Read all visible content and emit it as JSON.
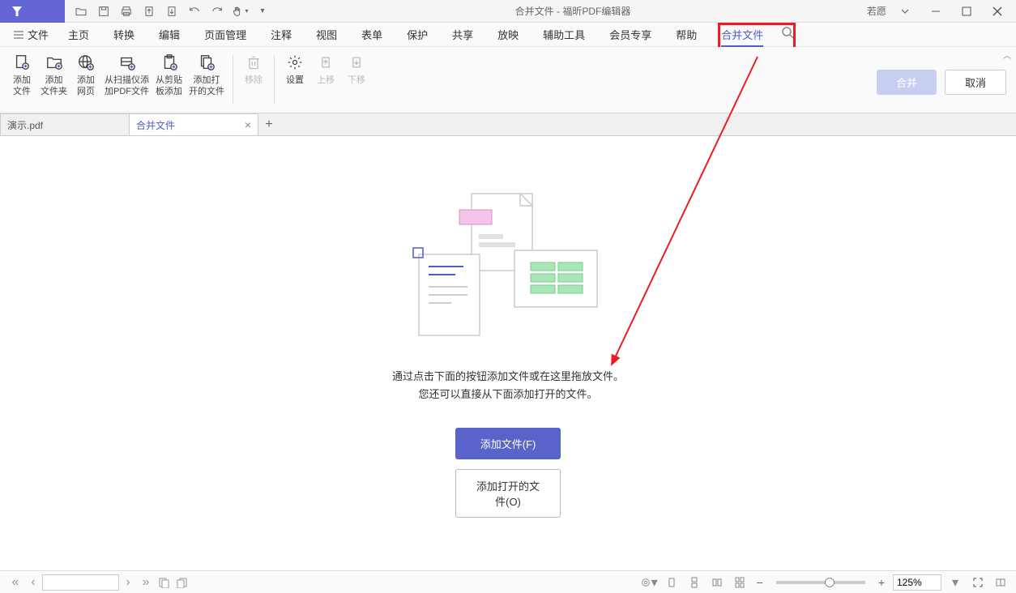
{
  "titlebar": {
    "title": "合并文件 - 福昕PDF编辑器",
    "user": "若愿"
  },
  "menu": {
    "file": "文件",
    "items": [
      "主页",
      "转换",
      "编辑",
      "页面管理",
      "注释",
      "视图",
      "表单",
      "保护",
      "共享",
      "放映",
      "辅助工具",
      "会员专享",
      "帮助",
      "合并文件"
    ]
  },
  "ribbon": {
    "add_file": "添加\n文件",
    "add_folder": "添加\n文件夹",
    "add_web": "添加\n网页",
    "add_scan": "从扫描仪添\n加PDF文件",
    "add_clip": "从剪贴\n板添加",
    "add_open": "添加打\n开的文件",
    "remove": "移除",
    "settings": "设置",
    "move_up": "上移",
    "move_down": "下移",
    "merge": "合并",
    "cancel": "取消"
  },
  "tabs": {
    "tab1": "演示.pdf",
    "tab2": "合并文件"
  },
  "content": {
    "line1": "通过点击下面的按钮添加文件或在这里拖放文件。",
    "line2": "您还可以直接从下面添加打开的文件。",
    "add_files": "添加文件(F)",
    "add_open": "添加打开的文件(O)"
  },
  "statusbar": {
    "zoom": "125%"
  }
}
